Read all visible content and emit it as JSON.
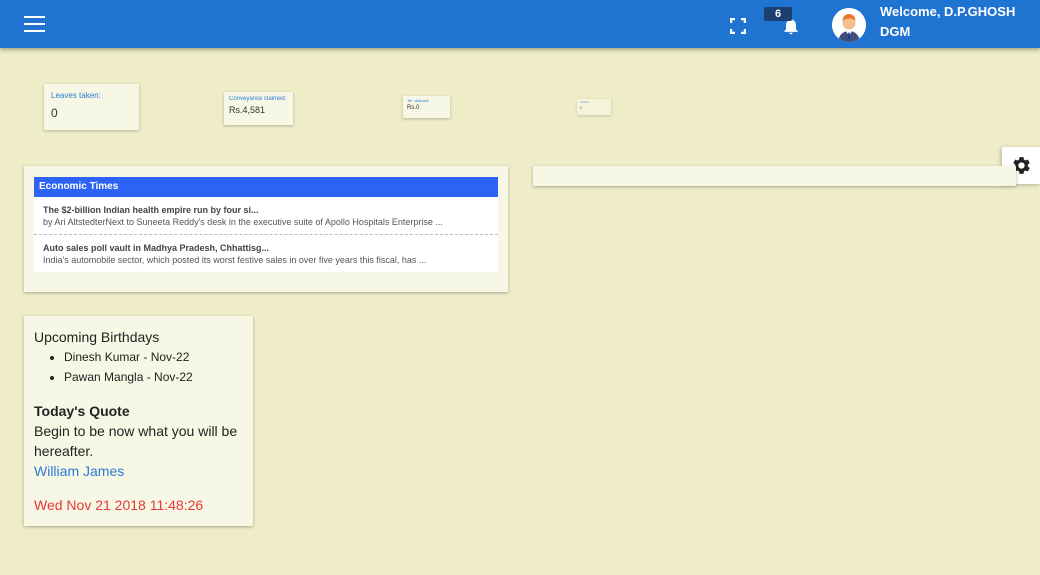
{
  "header": {
    "notification_count": "6",
    "welcome_line1": "Welcome, D.P.GHOSH",
    "welcome_line2": "DGM"
  },
  "stats": [
    {
      "label": "Leaves taken:",
      "value": "0"
    },
    {
      "label": "Conveyance claimed:",
      "value": "Rs.4,581"
    },
    {
      "label": "Tel. claimed:",
      "value": "Rs.0"
    },
    {
      "label": "Claims:",
      "value": "0"
    }
  ],
  "news": {
    "source": "Economic Times",
    "items": [
      {
        "title": "The $2-billion Indian health empire run by four si...",
        "desc": "by Ari AltstedterNext to Suneeta Reddy's desk in the executive suite of Apollo Hospitals Enterprise ..."
      },
      {
        "title": "Auto sales poll vault in Madhya Pradesh, Chhattisg...",
        "desc": "India's automobile sector, which posted its worst festive sales in over five years this fiscal, has ..."
      }
    ]
  },
  "birthdays": {
    "title": "Upcoming Birthdays",
    "people": [
      "Dinesh Kumar - Nov-22",
      "Pawan Mangla - Nov-22"
    ]
  },
  "quote": {
    "title": "Today's Quote",
    "text": "Begin to be now what you will be hereafter.",
    "author": "William James"
  },
  "datetime": "Wed Nov 21 2018 11:48:26",
  "colors": {
    "topbar": "#1f74d2",
    "accent": "#2b7bd6",
    "news_header": "#2d63f4",
    "datetime": "#e53935",
    "background": "#efedc8"
  },
  "icons": [
    "hamburger-icon",
    "fullscreen-icon",
    "bell-icon",
    "avatar",
    "gear-icon"
  ]
}
